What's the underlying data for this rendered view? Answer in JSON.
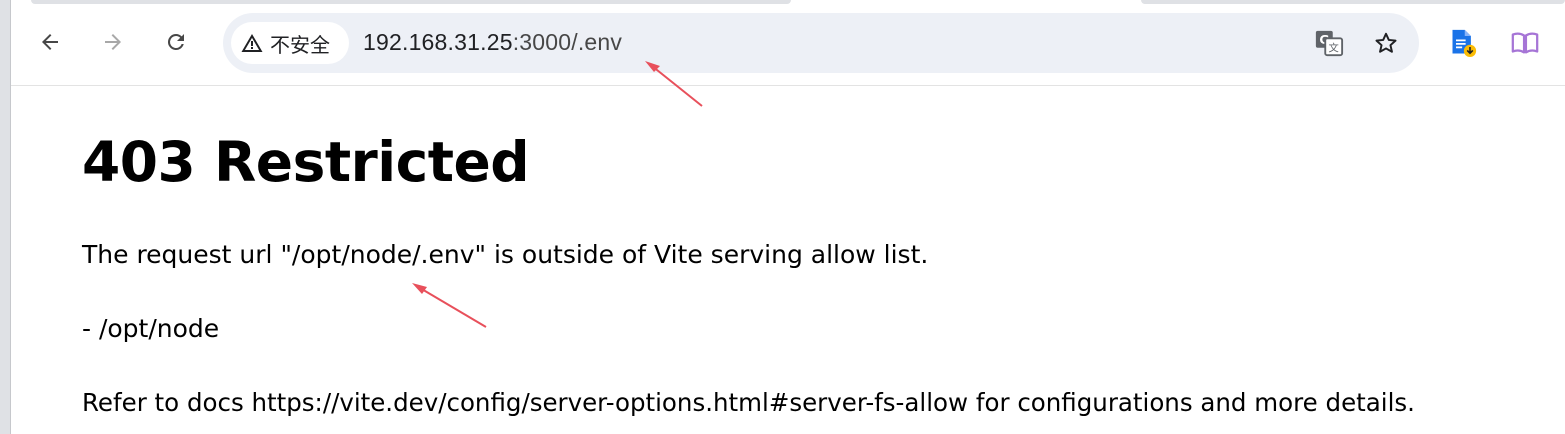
{
  "browser": {
    "security_label": "不安全",
    "url_host": "192.168.31.25",
    "url_rest": ":3000/.env",
    "icons": {
      "back": "arrow-left-icon",
      "forward": "arrow-right-icon",
      "reload": "reload-icon",
      "security": "warning-triangle-icon",
      "translate": "translate-icon",
      "bookmark": "star-icon",
      "extension_doc": "document-download-icon",
      "reading_mode": "book-icon"
    },
    "colors": {
      "accent_blue": "#1a73e8",
      "reader_purple": "#a675d6",
      "annotation_red": "#e8505b"
    }
  },
  "page": {
    "heading": "403 Restricted",
    "message": "The request url \"/opt/node/.env\" is outside of Vite serving allow list.",
    "allow_item": "- /opt/node",
    "docs_text": "Refer to docs https://vite.dev/config/server-options.html#server-fs-allow for configurations and more details."
  }
}
